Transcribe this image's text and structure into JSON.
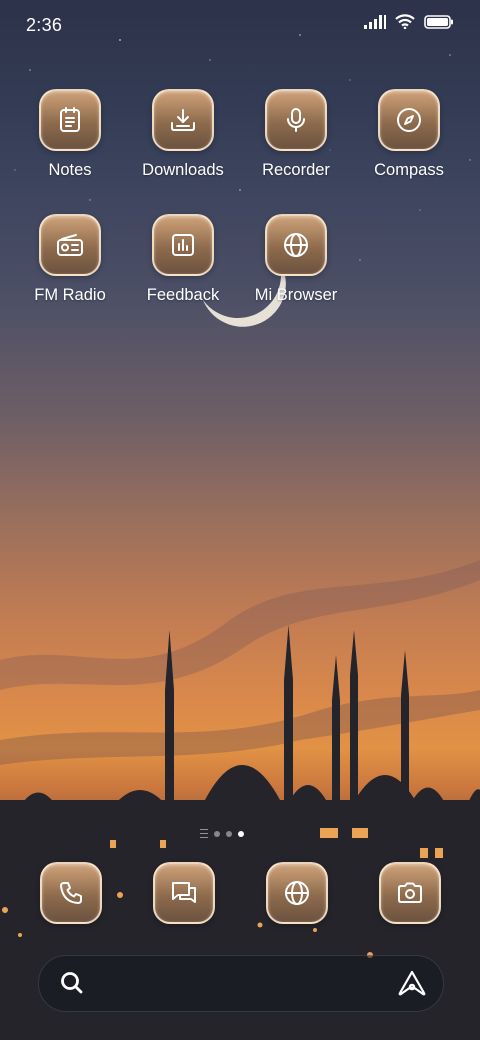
{
  "status_bar": {
    "time": "2:36",
    "icons": [
      "signal-icon",
      "wifi-icon",
      "battery-icon"
    ]
  },
  "apps": [
    {
      "label": "Notes",
      "icon": "notes-icon"
    },
    {
      "label": "Downloads",
      "icon": "download-icon"
    },
    {
      "label": "Recorder",
      "icon": "microphone-icon"
    },
    {
      "label": "Compass",
      "icon": "compass-icon"
    },
    {
      "label": "FM Radio",
      "icon": "radio-icon"
    },
    {
      "label": "Feedback",
      "icon": "feedback-chart-icon"
    },
    {
      "label": "Mi Browser",
      "icon": "globe-icon"
    }
  ],
  "page_indicator": {
    "pages": 2,
    "current": 2
  },
  "dock": [
    {
      "icon": "phone-icon"
    },
    {
      "icon": "messages-icon"
    },
    {
      "icon": "globe-icon"
    },
    {
      "icon": "camera-icon"
    }
  ],
  "search_bar": {
    "search_icon": "search-icon",
    "assistant_icon": "assistant-icon"
  },
  "colors": {
    "icon_tile": "#a07a58",
    "icon_border": "#ffecd2"
  }
}
